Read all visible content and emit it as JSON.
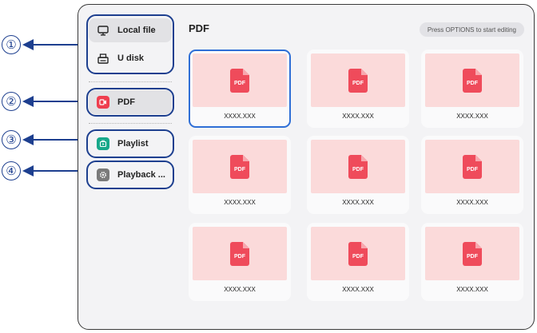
{
  "callouts": [
    "①",
    "②",
    "③",
    "④"
  ],
  "sidebar": {
    "items": [
      {
        "label": "Local file",
        "icon": "monitor-icon"
      },
      {
        "label": "U disk",
        "icon": "usb-drive-icon"
      },
      {
        "label": "PDF",
        "icon": "pdf-app-icon",
        "color": "#ef3e4f"
      },
      {
        "label": "Playlist",
        "icon": "playlist-icon",
        "color": "#17a88a"
      },
      {
        "label": "Playback ...",
        "icon": "gear-icon",
        "color": "#7a7a7a"
      }
    ]
  },
  "main": {
    "title": "PDF",
    "hint": "Press OPTIONS to start editing",
    "files": [
      {
        "name": "XXXX.XXX",
        "badge": "PDF"
      },
      {
        "name": "XXXX.XXX",
        "badge": "PDF"
      },
      {
        "name": "XXXX.XXX",
        "badge": "PDF"
      },
      {
        "name": "XXXX.XXX",
        "badge": "PDF"
      },
      {
        "name": "XXXX.XXX",
        "badge": "PDF"
      },
      {
        "name": "XXXX.XXX",
        "badge": "PDF"
      },
      {
        "name": "XXXX.XXX",
        "badge": "PDF"
      },
      {
        "name": "XXXX.XXX",
        "badge": "PDF"
      },
      {
        "name": "XXXX.XXX",
        "badge": "PDF"
      }
    ]
  },
  "colors": {
    "callout": "#1d3f8f",
    "selection": "#2f6fd6",
    "thumb_bg": "#fbdada",
    "pdf_icon": "#ef4b5b"
  }
}
